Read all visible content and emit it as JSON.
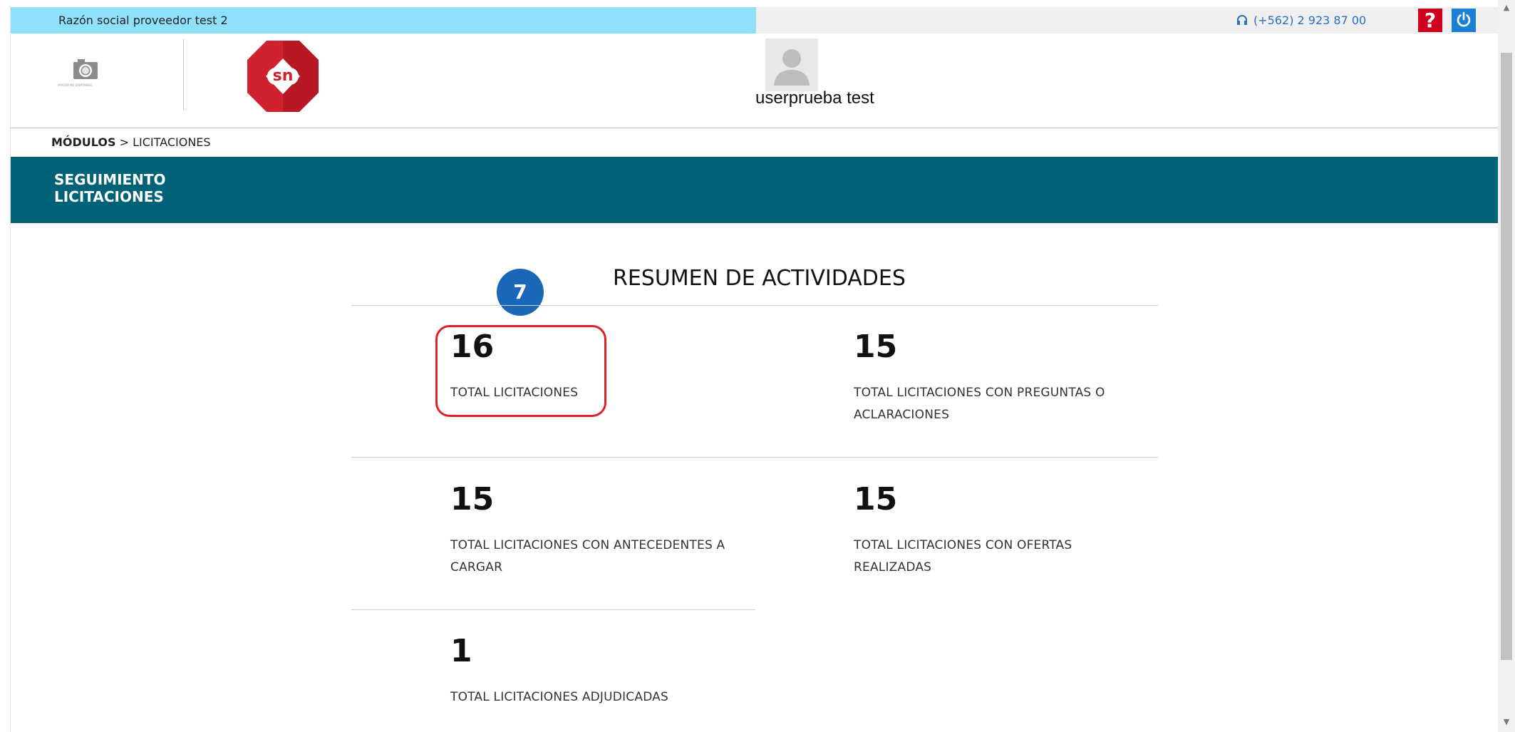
{
  "topbar": {
    "company_name": "Razón social proveedor test 2",
    "phone": "(+562) 2 923 87 00",
    "help_label": "?"
  },
  "header": {
    "camera_caption": "IMAGEN NO DISPONIBLE",
    "logo_text": "sn",
    "username": "userprueba test"
  },
  "breadcrumb": {
    "module": "MÓDULOS",
    "separator": " > ",
    "current": "LICITACIONES"
  },
  "banner": {
    "title_line1": "SEGUIMIENTO",
    "title_line2": "LICITACIONES"
  },
  "summary": {
    "title": "RESUMEN DE ACTIVIDADES",
    "step_number": "7",
    "stats": [
      {
        "value": "16",
        "label": "TOTAL LICITACIONES"
      },
      {
        "value": "15",
        "label": "TOTAL LICITACIONES CON PREGUNTAS O ACLARACIONES"
      },
      {
        "value": "15",
        "label": "TOTAL LICITACIONES CON ANTECEDENTES A CARGAR"
      },
      {
        "value": "15",
        "label": "TOTAL LICITACIONES CON OFERTAS REALIZADAS"
      },
      {
        "value": "1",
        "label": "TOTAL LICITACIONES ADJUDICADAS"
      }
    ]
  },
  "colors": {
    "company_bar": "#8fe1fb",
    "banner": "#006277",
    "help_button": "#d0021b",
    "power_button": "#1c7fd6",
    "step_badge": "#1a66b7",
    "highlight": "#e0202a",
    "logo_red": "#d0212e"
  },
  "icons": {
    "camera": "camera-icon",
    "headset": "headset-icon",
    "help": "help-icon",
    "power": "power-icon",
    "avatar": "user-avatar-icon"
  }
}
